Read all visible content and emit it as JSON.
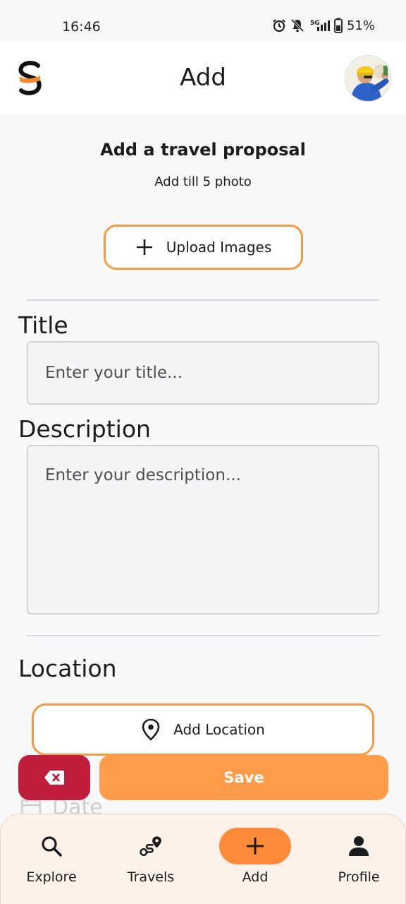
{
  "status_bar": {
    "time": "16:46",
    "network": "5G",
    "battery": "51%"
  },
  "app_bar": {
    "title": "Add",
    "logo_icon": "app-logo-s",
    "avatar": "user-avatar"
  },
  "form": {
    "heading": "Add a travel proposal",
    "subheading": "Add till 5 photo",
    "upload_label": "Upload Images",
    "title_label": "Title",
    "title_placeholder": "Enter your title...",
    "title_value": "",
    "description_label": "Description",
    "description_placeholder": "Enter your description...",
    "description_value": "",
    "location_label": "Location",
    "add_location_label": "Add Location",
    "date_label": "Date"
  },
  "actions": {
    "save_label": "Save",
    "delete_icon": "backspace-icon"
  },
  "bottom_nav": {
    "items": [
      {
        "label": "Explore",
        "icon": "search-icon",
        "active": false
      },
      {
        "label": "Travels",
        "icon": "route-icon",
        "active": false
      },
      {
        "label": "Add",
        "icon": "plus-icon",
        "active": true
      },
      {
        "label": "Profile",
        "icon": "person-icon",
        "active": false
      }
    ]
  },
  "colors": {
    "accent": "#ff9c4a",
    "accent_border": "#f39a47",
    "danger": "#bf1d3b",
    "nav_background": "#fdf2ea",
    "active_pill": "#ff8a3a"
  }
}
